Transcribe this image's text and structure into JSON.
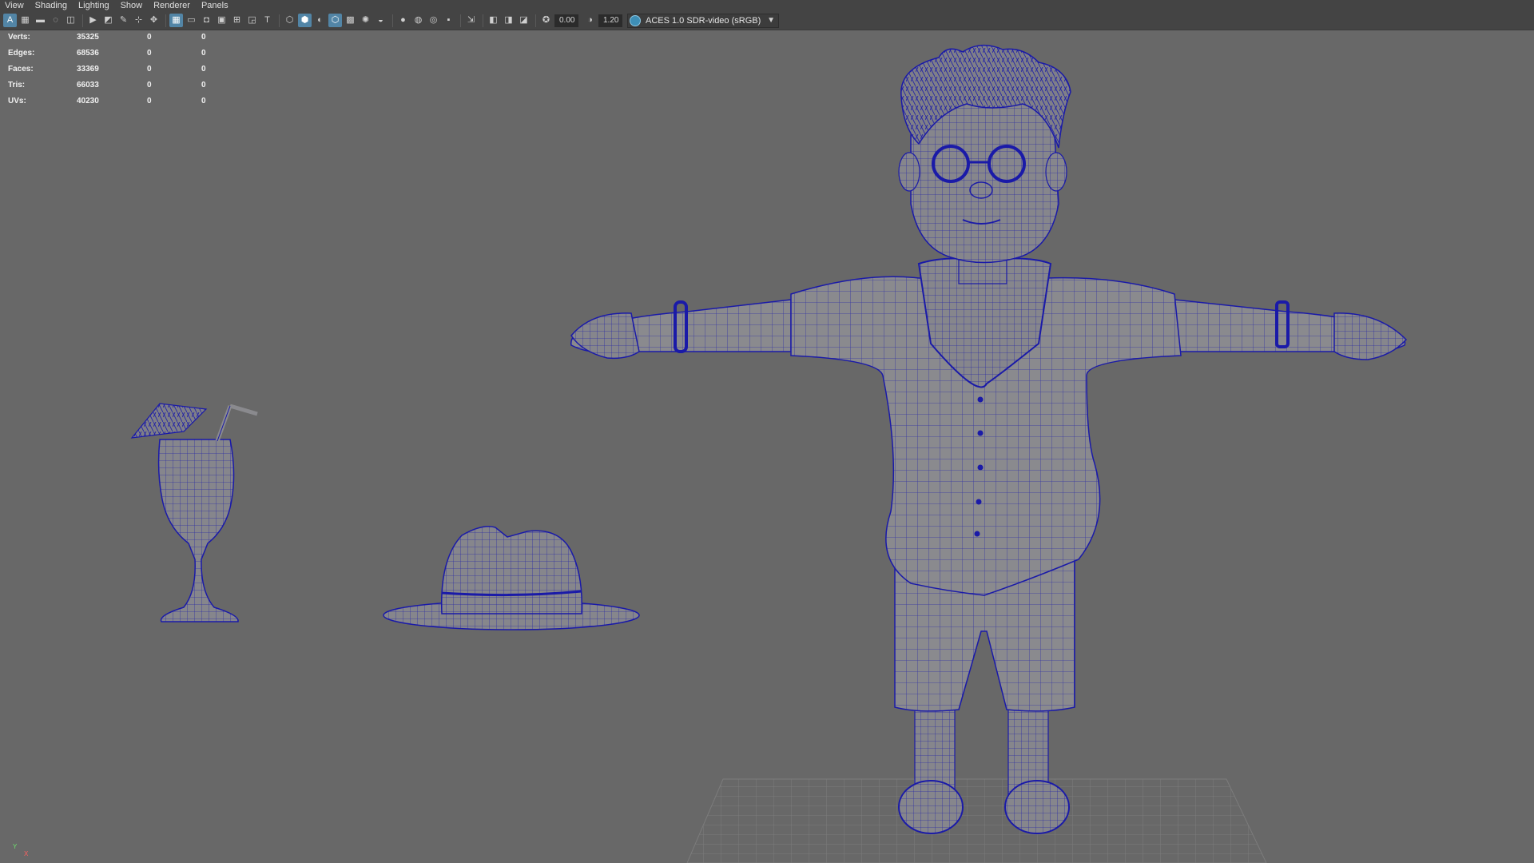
{
  "menu": [
    "View",
    "Shading",
    "Lighting",
    "Show",
    "Renderer",
    "Panels"
  ],
  "toolbar": {
    "exposure_value": "0.00",
    "gamma_value": "1.20",
    "color_management_label": "ACES 1.0 SDR-video (sRGB)"
  },
  "hud": {
    "rows": [
      {
        "label": "Verts:",
        "total": "35325",
        "selected": "0",
        "components": "0"
      },
      {
        "label": "Edges:",
        "total": "68536",
        "selected": "0",
        "components": "0"
      },
      {
        "label": "Faces:",
        "total": "33369",
        "selected": "0",
        "components": "0"
      },
      {
        "label": "Tris:",
        "total": "66033",
        "selected": "0",
        "components": "0"
      },
      {
        "label": "UVs:",
        "total": "40230",
        "selected": "0",
        "components": "0"
      }
    ]
  },
  "axis": {
    "y": "Y",
    "x": "X"
  },
  "colors": {
    "viewport_bg": "#686868",
    "wire": "#1a1aa8",
    "mesh_fill": "#8a8a8e",
    "grid": "#7a7a7a",
    "toolbar_active": "#5285a6"
  }
}
